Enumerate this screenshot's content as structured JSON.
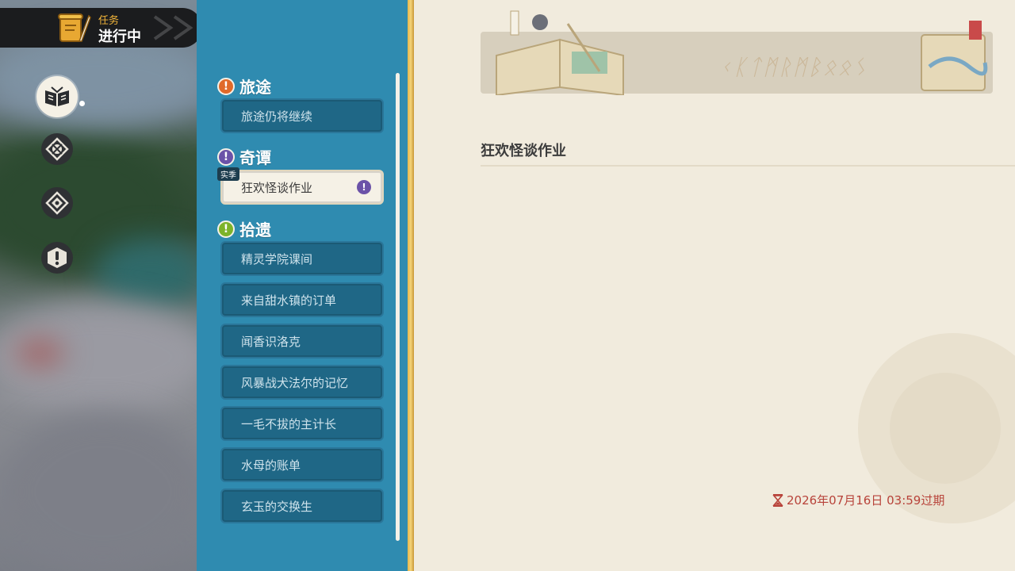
{
  "header": {
    "subtitle": "任务",
    "title": "进行中",
    "icon": "scroll-quill-icon"
  },
  "categories": [
    {
      "icon": "open-book-icon",
      "active": true
    },
    {
      "icon": "compass-badge-icon",
      "active": false
    },
    {
      "icon": "compass-badge-icon",
      "active": false
    },
    {
      "icon": "exclamation-icon",
      "active": false
    }
  ],
  "sections": {
    "journey": {
      "label": "旅途",
      "color": "#e06a2a",
      "items": [
        {
          "label": "旅途仍将继续"
        }
      ]
    },
    "wonder": {
      "label": "奇谭",
      "color": "#6b52a8",
      "tag": "实季",
      "items": [
        {
          "label": "狂欢怪谈作业",
          "selected": true
        }
      ]
    },
    "gleaning": {
      "label": "拾遗",
      "color": "#7cb32a",
      "items": [
        {
          "label": "精灵学院课间"
        },
        {
          "label": "来自甜水镇的订单"
        },
        {
          "label": "闻香识洛克"
        },
        {
          "label": "风暴战犬法尔的记忆"
        },
        {
          "label": "一毛不拔的主计长"
        },
        {
          "label": "水母的账单"
        },
        {
          "label": "玄玉的交换生"
        }
      ]
    }
  },
  "detail": {
    "banner_icon": "open-book-map-icon",
    "title": "狂欢怪谈作业",
    "expire_icon": "hourglass-icon",
    "expire_text": "2026年07月16日 03:59过期"
  },
  "colors": {
    "panel": "#2f8bb0",
    "item": "#1f6786",
    "accent_border": "#e7b64a",
    "expire": "#b8433a"
  }
}
